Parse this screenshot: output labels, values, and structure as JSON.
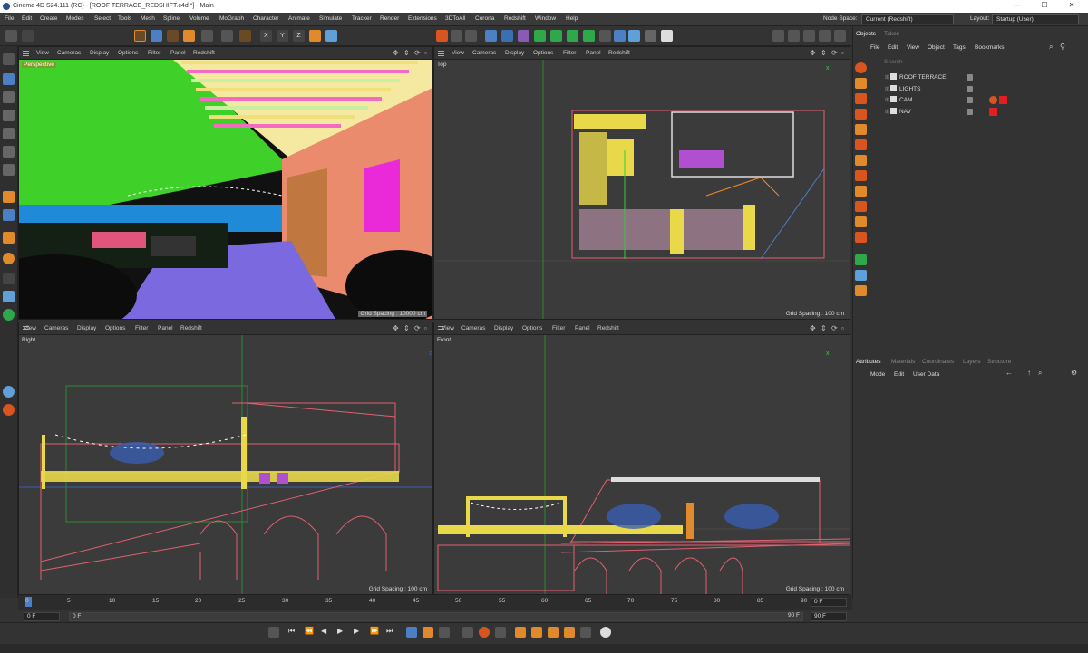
{
  "window": {
    "title": "Cinema 4D S24.111 (RC) - [ROOF TERRACE_REDSHIFT.c4d *] - Main",
    "minimize": "—",
    "maximize": "☐",
    "close": "✕"
  },
  "menu": [
    "File",
    "Edit",
    "Create",
    "Modes",
    "Select",
    "Tools",
    "Mesh",
    "Spline",
    "Volume",
    "MoGraph",
    "Character",
    "Animate",
    "Simulate",
    "Tracker",
    "Render",
    "Extensions",
    "3DToAll",
    "Corona",
    "Redshift",
    "Window",
    "Help"
  ],
  "node_space": {
    "label": "Node Space:",
    "value": "Current (Redshift)"
  },
  "layout": {
    "label": "Layout:",
    "value": "Startup (User)"
  },
  "toolbar": {
    "axis_x": "X",
    "axis_y": "Y",
    "axis_z": "Z"
  },
  "viewport_menu": [
    "View",
    "Cameras",
    "Display",
    "Options",
    "Filter",
    "Panel",
    "Redshift"
  ],
  "viewports": {
    "perspective": {
      "label": "Perspective",
      "grid": "Grid Spacing : 10000 cm"
    },
    "top": {
      "label": "Top",
      "grid": "Grid Spacing : 100 cm"
    },
    "right": {
      "label": "Right",
      "grid": "Grid Spacing : 100 cm"
    },
    "front": {
      "label": "Front",
      "grid": "Grid Spacing : 100 cm"
    }
  },
  "axis_labels": {
    "x": "x",
    "y": "y",
    "z": "z"
  },
  "objects_panel": {
    "tabs": [
      "Objects",
      "Takes"
    ],
    "menu": [
      "File",
      "Edit",
      "View",
      "Object",
      "Tags",
      "Bookmarks"
    ],
    "search_placeholder": "Search",
    "items": [
      "ROOF TERRACE",
      "LIGHTS",
      "CAM",
      "NAV"
    ]
  },
  "attributes_panel": {
    "tabs": [
      "Attributes",
      "Materials",
      "Coordinates",
      "Layers",
      "Structure"
    ],
    "menu": [
      "Mode",
      "Edit",
      "User Data"
    ]
  },
  "timeline": {
    "ticks": [
      "0",
      "5",
      "10",
      "15",
      "20",
      "25",
      "30",
      "35",
      "40",
      "45",
      "50",
      "55",
      "60",
      "65",
      "70",
      "75",
      "80",
      "85",
      "90"
    ],
    "current_frame": "0 F",
    "start_field": "0 F",
    "start_field2": "0 F",
    "end_field": "90 F",
    "end_field2": "90 F",
    "max_field": "90 F"
  },
  "colors": {
    "accent": "#e08a2c",
    "selected_blue": "#4d7fc4",
    "viewport_bg": "#3b3b3b",
    "panel_bg": "#333333"
  }
}
